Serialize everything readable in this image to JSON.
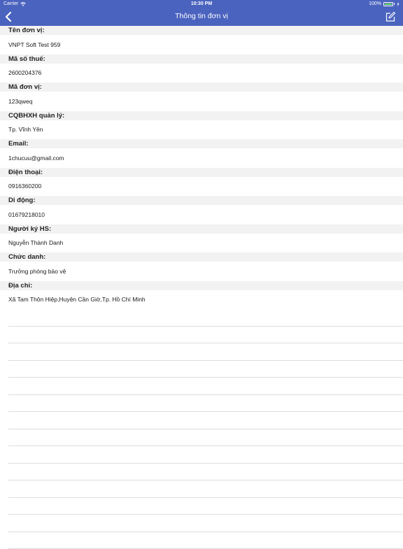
{
  "status": {
    "carrier": "Carrier",
    "time": "10:30 PM",
    "battery": "100%",
    "battery_level": 1.0
  },
  "nav": {
    "title": "Thông tin đơn vị",
    "back_icon": "chevron-left-icon",
    "edit_icon": "edit-icon"
  },
  "fields": [
    {
      "label": "Tên đơn vị:",
      "value": "VNPT Soft Test 959"
    },
    {
      "label": "Mã số thuế:",
      "value": "2600204376"
    },
    {
      "label": "Mã đơn vị:",
      "value": "123qweq"
    },
    {
      "label": "CQBHXH quản lý:",
      "value": "Tp. Vĩnh Yên"
    },
    {
      "label": "Email:",
      "value": "1chucuu@gmail.com"
    },
    {
      "label": "Điện thoại:",
      "value": "0916360200"
    },
    {
      "label": "Di động:",
      "value": "01679218010"
    },
    {
      "label": "Người ký HS:",
      "value": "Nguyễn Thành Danh"
    },
    {
      "label": "Chức danh:",
      "value": "Trưởng phòng bảo vệ"
    },
    {
      "label": "Địa chỉ:",
      "value": "Xã Tam Thôn Hiệp,Huyện Cần Giờ,Tp. Hồ Chí Minh"
    }
  ],
  "colors": {
    "accent": "#4a63bf",
    "label_bg": "#f2f2f2",
    "separator": "#dddddd"
  }
}
